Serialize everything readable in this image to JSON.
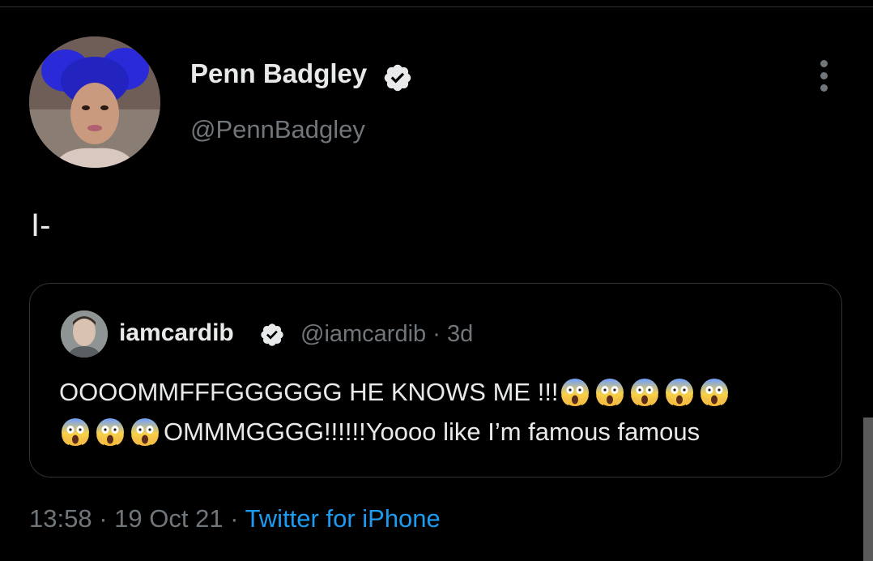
{
  "tweet": {
    "author": {
      "display_name": "Penn Badgley",
      "handle": "@PennBadgley",
      "verified": true,
      "avatar_icon": "profile-photo"
    },
    "text": "I-",
    "more_icon": "more-vertical-icon",
    "quoted": {
      "author_name": "iamcardib",
      "author_handle": "@iamcardib",
      "separator": "·",
      "relative_time": "3d",
      "verified": true,
      "line1_text": "OOOOMMFFFGGGGGG HE KNOWS ME !!!",
      "line1_emoji_count": 5,
      "line2_emoji_count": 3,
      "line2_text": "OMMMGGGG!!!!!!Yoooo like I’m famous famous",
      "emoji_icon": "face-screaming-in-fear-icon"
    },
    "meta": {
      "time": "13:58",
      "separator1": " · ",
      "date": "19 Oct 21",
      "separator2": " · ",
      "source": "Twitter for iPhone"
    }
  },
  "colors": {
    "background": "#000000",
    "primary_text": "#e7e9ea",
    "secondary_text": "#71767b",
    "link": "#1d9bf0",
    "verified_badge": "#e7e9ea",
    "border": "#2f3336"
  }
}
